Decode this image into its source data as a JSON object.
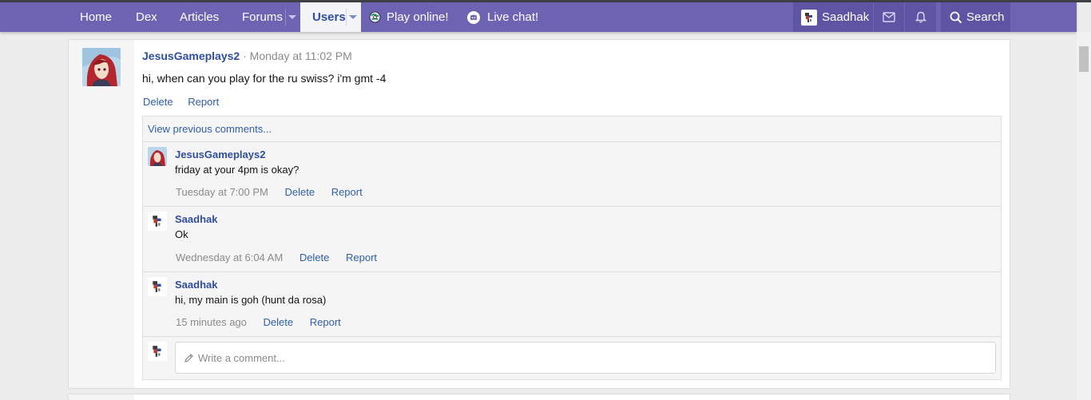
{
  "nav": {
    "home": "Home",
    "dex": "Dex",
    "articles": "Articles",
    "forums": "Forums",
    "users": "Users",
    "play_online": "Play online!",
    "live_chat": "Live chat!",
    "account": "Saadhak",
    "search": "Search"
  },
  "colors": {
    "navbar": "#6c63b3",
    "link": "#2f5fa8",
    "username": "#2f4ea0",
    "muted": "#8a8a8a"
  },
  "icons": {
    "conversations": "envelope-icon",
    "alerts": "bell-icon",
    "search": "magnifier-icon",
    "play_online": "pokeball-globe-icon",
    "live_chat": "discord-icon",
    "composer": "pencil-icon"
  },
  "post": {
    "author": "JesusGameplays2",
    "separator": "·",
    "time": "Monday at 11:02 PM",
    "text": "hi, when can you play for the ru swiss? i'm gmt -4",
    "delete_label": "Delete",
    "report_label": "Report"
  },
  "comments": {
    "view_previous": "View previous comments...",
    "items": [
      {
        "author": "JesusGameplays2",
        "text": "friday at your 4pm is okay?",
        "time": "Tuesday at 7:00 PM",
        "delete_label": "Delete",
        "report_label": "Report"
      },
      {
        "author": "Saadhak",
        "text": "Ok",
        "time": "Wednesday at 6:04 AM",
        "delete_label": "Delete",
        "report_label": "Report"
      },
      {
        "author": "Saadhak",
        "text": "hi, my main is goh (hunt da rosa)",
        "time": "15 minutes ago",
        "delete_label": "Delete",
        "report_label": "Report"
      }
    ],
    "write_placeholder": "Write a comment..."
  }
}
